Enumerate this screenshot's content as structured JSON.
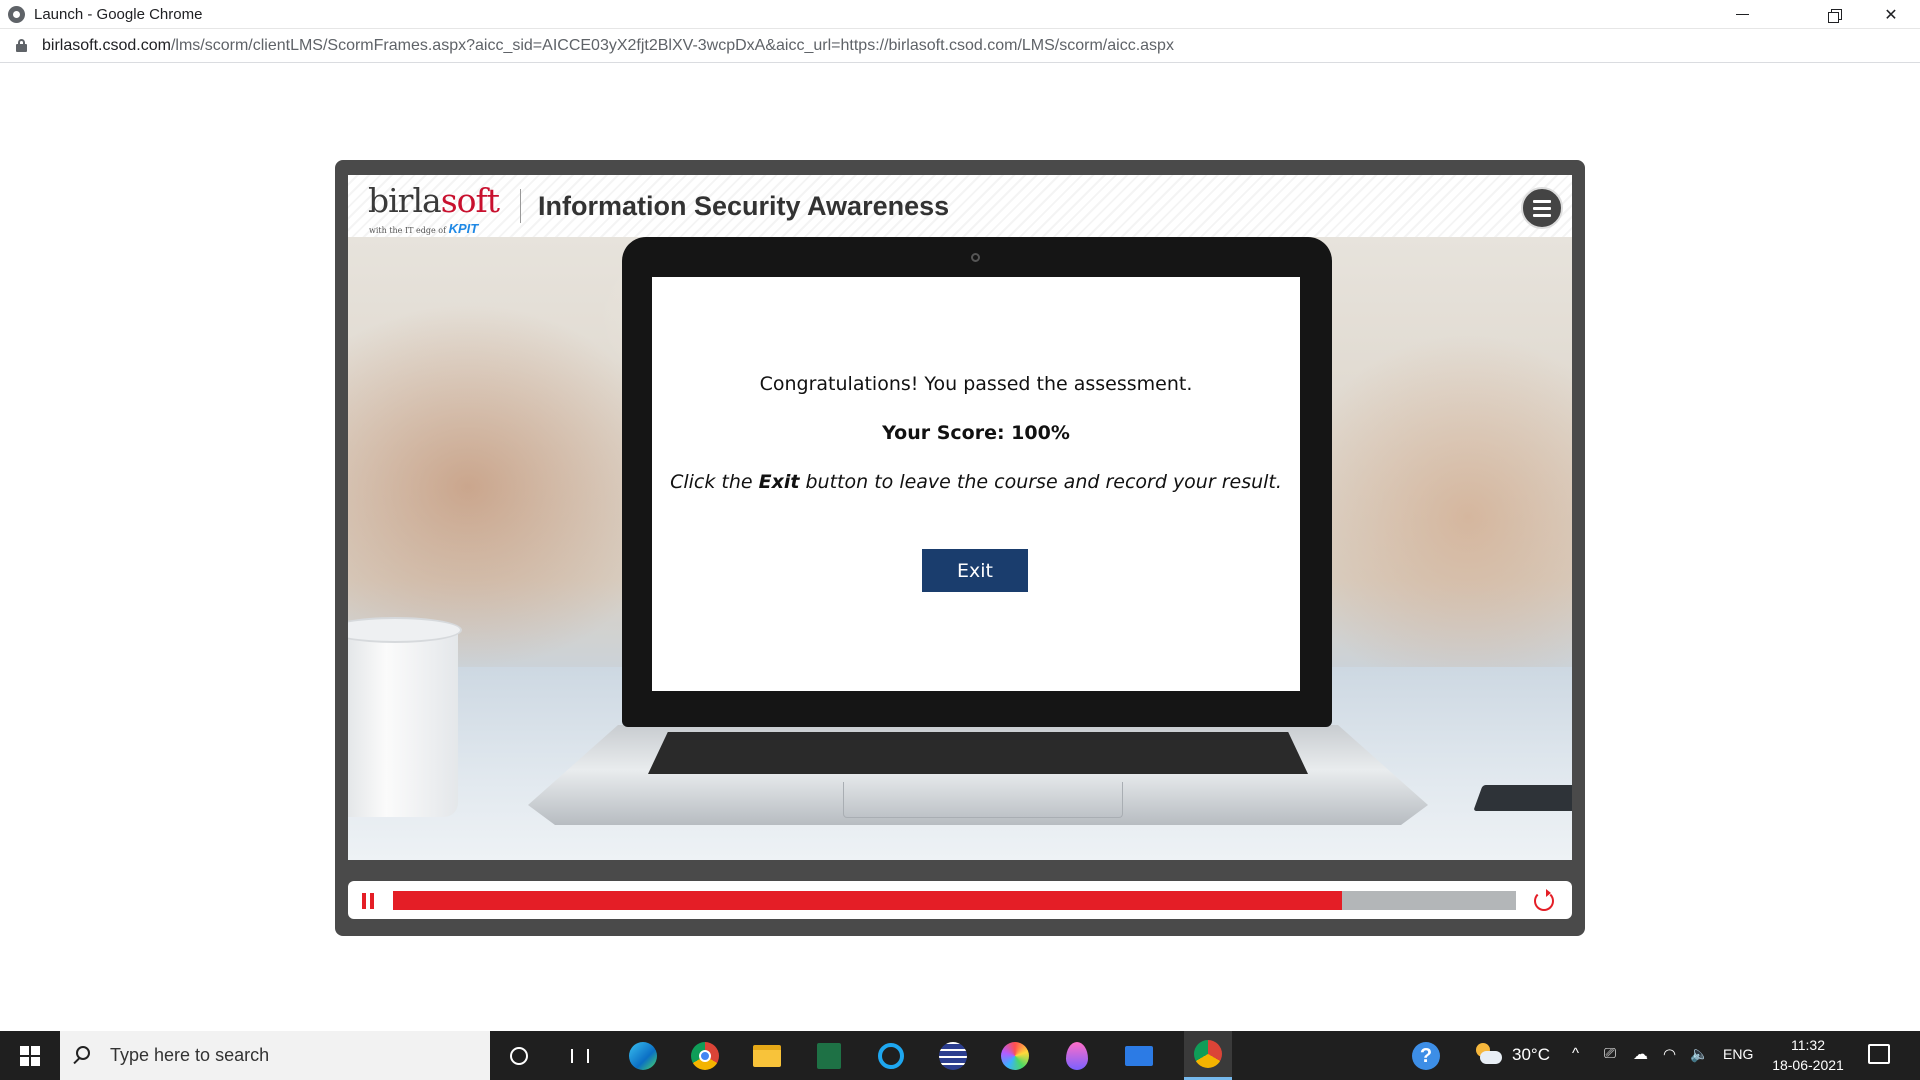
{
  "window": {
    "title": "Launch - Google Chrome",
    "minimize_glyph": "—",
    "close_glyph": "✕"
  },
  "address_bar": {
    "host": "birlasoft.csod.com",
    "path": "/lms/scorm/clientLMS/ScormFrames.aspx?aicc_sid=AICCE03yX2fjt2BlXV-3wcpDxA&aicc_url=https://birlasoft.csod.com/LMS/scorm/aicc.aspx"
  },
  "course": {
    "logo": {
      "word_main": "birla",
      "word_accent": "soft",
      "tagline": "with the IT edge of",
      "tagline_brand": "KPIT"
    },
    "title": "Information Security Awareness",
    "message": {
      "congrats": "Congratulations! You passed the assessment.",
      "score": "Your Score: 100%",
      "instruction_prefix": "Click the ",
      "instruction_bold": "Exit",
      "instruction_suffix": " button to leave the course and record your result."
    },
    "exit_label": "Exit",
    "progress_fraction": 0.845
  },
  "taskbar": {
    "search_placeholder": "Type here to search",
    "apps": [
      "cortana-icon",
      "task-view-icon",
      "edge-icon",
      "chrome-icon",
      "file-explorer-icon",
      "excel-icon",
      "cortana-ring-icon",
      "vpn-icon",
      "paint-icon",
      "drop-icon",
      "mail-icon",
      "chrome-active-icon"
    ],
    "help_glyph": "?",
    "temperature": "30°C",
    "chevron_glyph": "^",
    "meet_glyph": "⎚",
    "cloud_glyph": "☁",
    "wifi_glyph": "◠",
    "volume_glyph": "🔈",
    "language": "ENG",
    "time": "11:32",
    "date": "18-06-2021"
  },
  "colors": {
    "accent_red": "#e41e26",
    "exit_button": "#1a3d6d",
    "player_frame": "#4a4a4a"
  }
}
